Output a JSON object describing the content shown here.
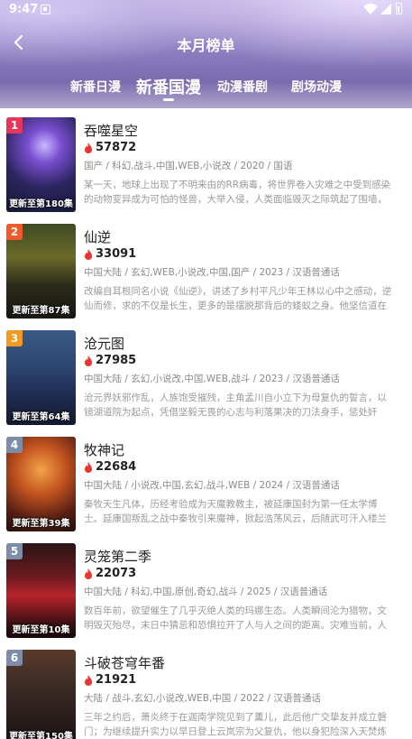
{
  "status_bar": {
    "time": "9:47"
  },
  "header": {
    "title": "本月榜单"
  },
  "tabs": [
    {
      "label": "新番日漫"
    },
    {
      "label": "新番国漫"
    },
    {
      "label": "动漫番剧"
    },
    {
      "label": "剧场动漫"
    }
  ],
  "colors": {
    "rank_1": "#e8365a",
    "rank_2": "#f15a2b",
    "rank_3": "#f39a1f",
    "rank_other": "#7f8ea8",
    "fire": "#e8362e"
  },
  "items": [
    {
      "rank": "1",
      "title": "吞噬星空",
      "heat": "57872",
      "meta": "国产 / 科幻,战斗,中国,WEB,小说改 / 2020 / 国语",
      "desc": "某一天，地球上出现了不明来由的RR病毒，将世界卷入灾难之中受到感染的动物变异成为可怕的怪兽，大举入侵，人类面临毁灭之际筑起了围墙，成立...",
      "episode": "更新至第180集"
    },
    {
      "rank": "2",
      "title": "仙逆",
      "heat": "33091",
      "meta": "中国大陆 / 玄幻,WEB,小说改,中国,国产 / 2023 / 汉语普通话",
      "desc": "改编自耳根同名小说《仙逆》，讲述了乡村平凡少年王林以心中之感动，逆仙而修，求的不仅是长生，更多的是摆脱那背后的蝼蚁之身。他坚信道在人为...",
      "episode": "更新至第87集"
    },
    {
      "rank": "3",
      "title": "沧元图",
      "heat": "27985",
      "meta": "中国大陆 / 玄幻,小说改,中国,WEB,战斗 / 2023 / 汉语普通话",
      "desc": "沧元界妖邪作乱，人族饱受摧残，主角孟川自小立下为母复仇的誓言，以镜湖道院为起点，凭借坚毅无畏的心志与利落果决的刀法身手，惩处奸恶，演灭...",
      "episode": "更新至第64集"
    },
    {
      "rank": "4",
      "title": "牧神记",
      "heat": "22684",
      "meta": "中国大陆 / 小说改,中国,玄幻,战斗,WEB / 2024 / 汉语普通话",
      "desc": "秦牧天生凡体，历经考验成为天魔教教主，被延康国封为第一任太学博士。延康国叛乱之战中秦牧引来魔神，掀起浩荡风云，后随武可汗入楼兰黄金宫，...",
      "episode": "更新至第39集"
    },
    {
      "rank": "5",
      "title": "灵笼第二季",
      "heat": "22073",
      "meta": "中国大陆 / 科幻,中国,原创,奇幻,战斗 / 2025 / 汉语普通话",
      "desc": "数百年前，欲望催生了几乎灭绝人类的玛娜生态。人类瞬间沦为猎物，文明毁灭殆尽，末日中猜忌和恐惧拉开了人与人之间的距离。灾难当前，人们逐渐...",
      "episode": "更新至第10集"
    },
    {
      "rank": "6",
      "title": "斗破苍穹年番",
      "heat": "21921",
      "meta": "大陆 / 战斗,玄幻,小说改,WEB,中国 / 2022 / 汉语普通话",
      "desc": "三年之约后，萧炎终于在迦南学院见到了薰儿，此后他广交挚友并成立磐门；为继续提升实力以早日登上云岚宗为父复仇，他以身犯险深入天焚炼气塔吞噬陨...",
      "episode": "更新至第150集"
    }
  ]
}
